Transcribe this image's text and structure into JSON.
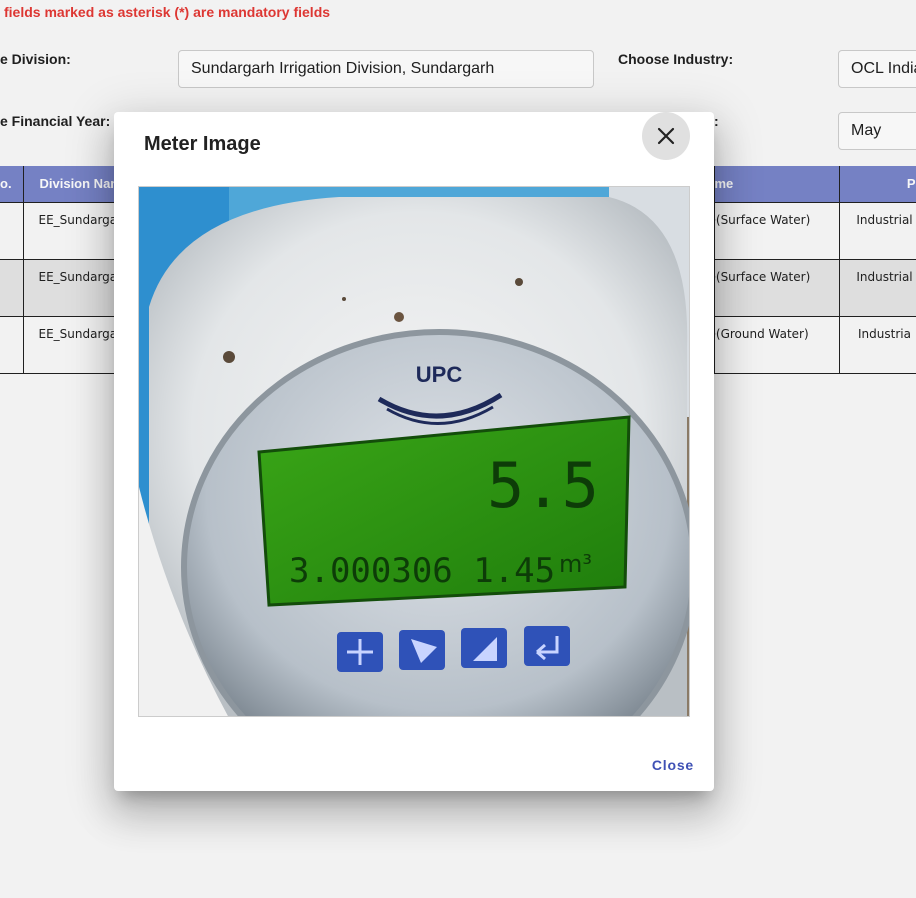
{
  "notice": "fields marked as asterisk (*) are mandatory fields",
  "form": {
    "division_label": "e Division:",
    "division_value": "Sundargarh Irrigation Division, Sundargarh",
    "industry_label": "Choose Industry:",
    "industry_value": "OCL India",
    "year_label": "e Financial Year:",
    "month_label_fragment": ":",
    "month_value": "May"
  },
  "table": {
    "headers": [
      "o.",
      "Division Nam",
      "me",
      "P"
    ],
    "rows": [
      {
        "division": "EE_Sundarga",
        "source": "e(Surface Water)",
        "purpose": "Industrial"
      },
      {
        "division": "EE_Sundarga",
        "source": "e(Surface Water)",
        "purpose": "Industrial"
      },
      {
        "division": "EE_Sundarga",
        "source": "e(Ground Water)",
        "purpose": "Industria"
      }
    ]
  },
  "modal": {
    "title": "Meter Image",
    "close_label": "Close",
    "close_icon": "close-icon",
    "meter_image": {
      "brand": "UPC",
      "flow_reading": "5.5",
      "total_reading": "3.000306 1.45",
      "unit": "m³"
    }
  },
  "colors": {
    "notice": "#e53935",
    "table_header": "#7986cb",
    "accent": "#3f51b5",
    "lcd": "#2e9a12"
  }
}
